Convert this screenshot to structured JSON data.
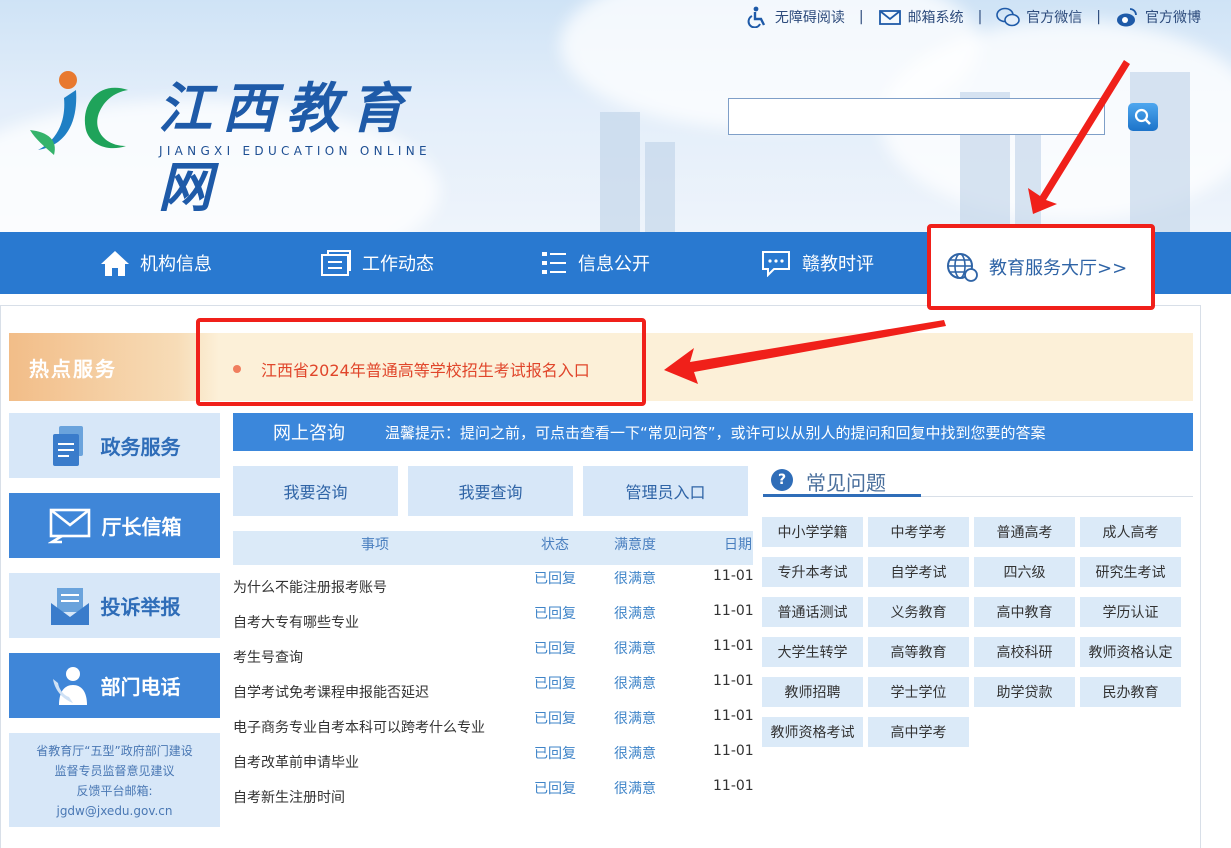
{
  "top_links": [
    {
      "label": "无障碍阅读",
      "icon": "accessibility-icon"
    },
    {
      "label": "邮箱系统",
      "icon": "mail-icon"
    },
    {
      "label": "官方微信",
      "icon": "wechat-icon"
    },
    {
      "label": "官方微博",
      "icon": "weibo-icon"
    }
  ],
  "top_sep": "|",
  "logo": {
    "title": "江西教育网",
    "subtitle": "JIANGXI EDUCATION ONLINE"
  },
  "search": {
    "value": "",
    "placeholder": ""
  },
  "nav": {
    "items": [
      "机构信息",
      "工作动态",
      "信息公开",
      "赣教时评"
    ],
    "service": "教育服务大厅>>"
  },
  "hot": {
    "label": "热点服务",
    "link": "江西省2024年普通高等学校招生考试报名入口"
  },
  "sidebar": {
    "buttons": [
      "政务服务",
      "厅长信箱",
      "投诉举报",
      "部门电话"
    ],
    "note": [
      "省教育厅“五型”政府部门建设",
      "监督专员监督意见建议",
      "反馈平台邮箱:",
      "jgdw@jxedu.gov.cn"
    ]
  },
  "consult": {
    "title": "网上咨询",
    "tip": "温馨提示：提问之前，可点击查看一下“常见问答”，或许可以从别人的提问和回复中找到您要的答案",
    "buttons": [
      "我要咨询",
      "我要查询",
      "管理员入口"
    ],
    "headers": [
      "事项",
      "状态",
      "满意度",
      "日期"
    ],
    "rows": [
      {
        "title": "为什么不能注册报考账号",
        "status": "已回复",
        "sat": "很满意",
        "date": "11-01"
      },
      {
        "title": "自考大专有哪些专业",
        "status": "已回复",
        "sat": "很满意",
        "date": "11-01"
      },
      {
        "title": "考生号查询",
        "status": "已回复",
        "sat": "很满意",
        "date": "11-01"
      },
      {
        "title": "自学考试免考课程申报能否延迟",
        "status": "已回复",
        "sat": "很满意",
        "date": "11-01"
      },
      {
        "title": "电子商务专业自考本科可以跨考什么专业",
        "status": "已回复",
        "sat": "很满意",
        "date": "11-01"
      },
      {
        "title": "自考改革前申请毕业",
        "status": "已回复",
        "sat": "很满意",
        "date": "11-01"
      },
      {
        "title": "自考新生注册时间",
        "status": "已回复",
        "sat": "很满意",
        "date": "11-01"
      }
    ]
  },
  "faq": {
    "title": "常见问题",
    "tags": [
      "中小学学籍",
      "中考学考",
      "普通高考",
      "成人高考",
      "专升本考试",
      "自学考试",
      "四六级",
      "研究生考试",
      "普通话测试",
      "义务教育",
      "高中教育",
      "学历认证",
      "大学生转学",
      "高等教育",
      "高校科研",
      "教师资格认定",
      "教师招聘",
      "学士学位",
      "助学贷款",
      "民办教育",
      "教师资格考试",
      "高中学考"
    ]
  },
  "colors": {
    "nav": "#2979d0",
    "highlight": "#f0201a",
    "accent": "#3b87db"
  }
}
